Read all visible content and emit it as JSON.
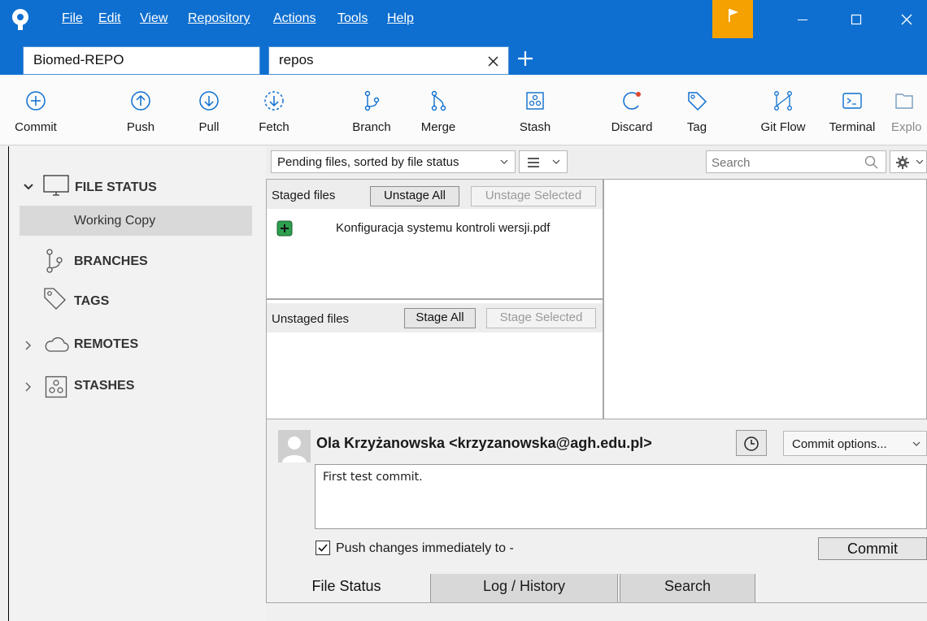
{
  "menu": [
    "File",
    "Edit",
    "View",
    "Repository",
    "Actions",
    "Tools",
    "Help"
  ],
  "tabs": [
    {
      "label": "Biomed-REPO"
    },
    {
      "label": "repos"
    }
  ],
  "toolbar": [
    {
      "label": "Commit",
      "icon": "plus-circle-icon"
    },
    {
      "label": "Push",
      "icon": "arrow-up-circle-icon"
    },
    {
      "label": "Pull",
      "icon": "arrow-down-circle-icon"
    },
    {
      "label": "Fetch",
      "icon": "dashed-arrow-down-circle-icon"
    },
    {
      "label": "Branch",
      "icon": "branch-icon"
    },
    {
      "label": "Merge",
      "icon": "merge-icon"
    },
    {
      "label": "Stash",
      "icon": "stash-icon"
    },
    {
      "label": "Discard",
      "icon": "discard-icon"
    },
    {
      "label": "Tag",
      "icon": "tag-icon"
    },
    {
      "label": "Git Flow",
      "icon": "git-flow-icon"
    },
    {
      "label": "Terminal",
      "icon": "terminal-icon"
    },
    {
      "label": "Explo",
      "icon": "explorer-icon"
    }
  ],
  "sidebar": {
    "file_status": "FILE STATUS",
    "working_copy": "Working Copy",
    "branches": "BRANCHES",
    "tags": "TAGS",
    "remotes": "REMOTES",
    "stashes": "STASHES"
  },
  "filterbar": {
    "sort": "Pending files, sorted by file status",
    "search_placeholder": "Search"
  },
  "staged": {
    "title": "Staged files",
    "unstage_all": "Unstage All",
    "unstage_selected": "Unstage Selected",
    "files": [
      "Konfiguracja systemu kontroli wersji.pdf"
    ]
  },
  "unstaged": {
    "title": "Unstaged files",
    "stage_all": "Stage All",
    "stage_selected": "Stage Selected"
  },
  "commit": {
    "author": "Ola Krzyżanowska <krzyzanowska@agh.edu.pl>",
    "options": "Commit options...",
    "message": "First test commit.",
    "push_label": "Push changes immediately to -",
    "push_checked": true,
    "button": "Commit"
  },
  "bottom_tabs": [
    "File Status",
    "Log / History",
    "Search"
  ],
  "colors": {
    "accent": "#0e6fd0",
    "flag": "#f5a100",
    "added": "#2d9f4f"
  }
}
